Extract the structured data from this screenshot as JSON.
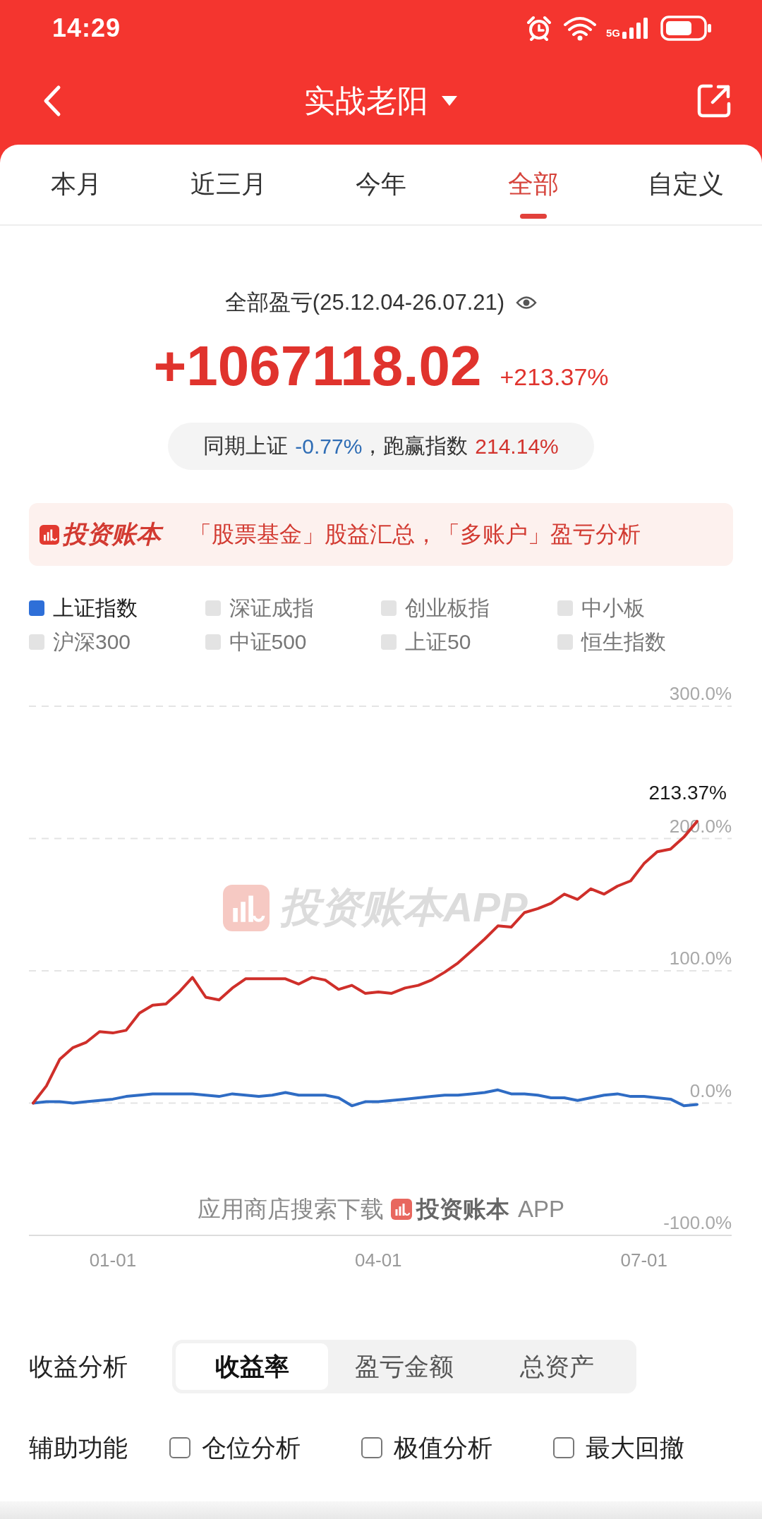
{
  "status_bar": {
    "time": "14:29",
    "network": "5G"
  },
  "nav": {
    "title": "实战老阳"
  },
  "tabs": [
    {
      "label": "本月",
      "selected": false
    },
    {
      "label": "近三月",
      "selected": false
    },
    {
      "label": "今年",
      "selected": false
    },
    {
      "label": "全部",
      "selected": true
    },
    {
      "label": "自定义",
      "selected": false
    }
  ],
  "summary": {
    "title": "全部盈亏(25.12.04-26.07.21)",
    "amount": "+1067118.02",
    "rate": "+213.37%",
    "comparison": [
      {
        "label": "同期上证",
        "value": "-0.77%",
        "color": "#2f6db5"
      },
      {
        "label": "，跑赢指数",
        "value": "214.14%",
        "color": "#d2342e"
      }
    ]
  },
  "banner": {
    "brand": "投资账本",
    "text": "「股票基金」股益汇总，「多账户」盈亏分析"
  },
  "legend": [
    {
      "label": "上证指数",
      "selected": true
    },
    {
      "label": "深证成指",
      "selected": false
    },
    {
      "label": "创业板指",
      "selected": false
    },
    {
      "label": "中小板",
      "selected": false
    },
    {
      "label": "沪深300",
      "selected": false
    },
    {
      "label": "中证500",
      "selected": false
    },
    {
      "label": "上证50",
      "selected": false
    },
    {
      "label": "恒生指数",
      "selected": false
    }
  ],
  "chart": {
    "chart_data": {
      "type": "line",
      "categories": [
        null,
        null,
        null,
        null,
        null,
        null,
        "01-01",
        null,
        null,
        null,
        null,
        null,
        null,
        null,
        null,
        null,
        null,
        null,
        null,
        null,
        null,
        null,
        null,
        null,
        null,
        null,
        "04-01",
        null,
        null,
        null,
        null,
        null,
        null,
        null,
        null,
        null,
        null,
        null,
        null,
        null,
        null,
        null,
        null,
        null,
        null,
        null,
        "07-01",
        null,
        null,
        null,
        null
      ],
      "series": [
        {
          "color": "#cf2f2a",
          "values": [
            0,
            13,
            33,
            42,
            46,
            54,
            53,
            55,
            68,
            74,
            75,
            84,
            95,
            80,
            78,
            87,
            94,
            94,
            94,
            94,
            90,
            95,
            93,
            86,
            89,
            83,
            84,
            83,
            87,
            89,
            93,
            99,
            106,
            115,
            124,
            134,
            133,
            144,
            147,
            151,
            158,
            154,
            162,
            158,
            164,
            168,
            181,
            190,
            192,
            201,
            213
          ]
        },
        {
          "color": "#2f6cc4",
          "values": [
            0,
            1,
            1,
            0,
            1,
            2,
            3,
            5,
            6,
            7,
            7,
            7,
            7,
            6,
            5,
            7,
            6,
            5,
            6,
            8,
            6,
            6,
            6,
            4,
            -2,
            1,
            1,
            2,
            3,
            4,
            5,
            6,
            6,
            7,
            8,
            10,
            7,
            7,
            6,
            4,
            4,
            2,
            4,
            6,
            7,
            5,
            5,
            4,
            3,
            -2,
            -1
          ]
        }
      ],
      "ylim": [
        -100,
        300
      ],
      "yticks": [
        {
          "value": 300,
          "label": "300.0%"
        },
        {
          "value": 200,
          "label": "200.0%"
        },
        {
          "value": 100,
          "label": "100.0%"
        },
        {
          "value": 0,
          "label": "0.0%"
        },
        {
          "value": -100,
          "label": "-100.0%"
        }
      ],
      "grid": true,
      "annotations": [
        "213.37%"
      ]
    },
    "watermark": "投资账本APP",
    "promo": {
      "text": "应用商店搜索下载",
      "brand": "投资账本",
      "suffix": "APP"
    }
  },
  "analysis": {
    "label": "收益分析",
    "options": [
      {
        "label": "收益率",
        "selected": true
      },
      {
        "label": "盈亏金额",
        "selected": false
      },
      {
        "label": "总资产",
        "selected": false
      }
    ]
  },
  "tools": {
    "label": "辅助功能",
    "options": [
      {
        "label": "仓位分析",
        "checked": false
      },
      {
        "label": "极值分析",
        "checked": false
      },
      {
        "label": "最大回撤",
        "checked": false
      }
    ]
  }
}
